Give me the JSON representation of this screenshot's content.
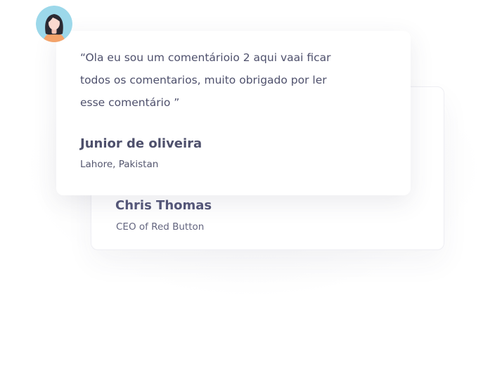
{
  "front_card": {
    "quote": "“Ola eu sou um comentárioio 2 aqui vaai ficar todos os comentarios, muito obrigado por ler esse comentário ”",
    "author_name": "Junior de oliveira",
    "author_location": "Lahore, Pakistan",
    "avatar_icon": "woman-avatar-icon"
  },
  "back_card": {
    "author_name": "Chris Thomas",
    "author_role": "CEO of Red Button"
  },
  "colors": {
    "avatar_background": "#9cd8ea",
    "avatar_hair": "#2b2a33",
    "avatar_skin": "#fad9cf",
    "avatar_shirt": "#f4a36a",
    "text_primary": "#4e506c"
  }
}
